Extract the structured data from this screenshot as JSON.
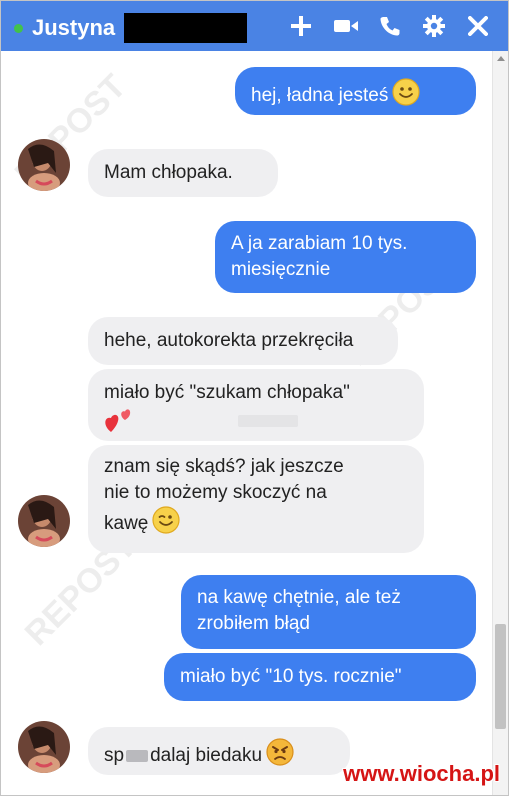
{
  "header": {
    "contact_name": "Justyna",
    "status_color": "#42c24a",
    "bg_color": "#4a83e4",
    "icons": [
      "plus-icon",
      "video-camera-icon",
      "phone-icon",
      "gear-icon",
      "close-icon"
    ]
  },
  "messages": [
    {
      "direction": "out",
      "lines": [
        "hej, ładna jesteś"
      ],
      "emoji": "smile-emoji"
    },
    {
      "direction": "in",
      "lines": [
        "Mam chłopaka."
      ],
      "avatar": true
    },
    {
      "direction": "out",
      "lines": [
        "A ja zarabiam 10 tys.",
        "miesięcznie"
      ]
    },
    {
      "direction": "in",
      "lines": [
        "hehe, autokorekta przekręciła"
      ]
    },
    {
      "direction": "in",
      "lines": [
        "miało być \"szukam chłopaka\""
      ],
      "emoji": "two-hearts-emoji"
    },
    {
      "direction": "in",
      "lines": [
        "znam się skądś? jak jeszcze",
        "nie to możemy skoczyć na",
        "kawę"
      ],
      "emoji": "wink-emoji",
      "avatar": true
    },
    {
      "direction": "out",
      "lines": [
        "na kawę chętnie, ale też",
        "zrobiłem błąd"
      ]
    },
    {
      "direction": "out",
      "lines": [
        "miało być \"10 tys. rocznie\""
      ]
    },
    {
      "direction": "in",
      "lines": [
        "sp",
        "dalaj biedaku"
      ],
      "emoji": "angry-emoji",
      "avatar": true
    }
  ],
  "watermark": {
    "site": "www.wiocha.pl"
  },
  "colors": {
    "outgoing_bubble": "#3e7ff0",
    "incoming_bubble": "#efeff1"
  }
}
